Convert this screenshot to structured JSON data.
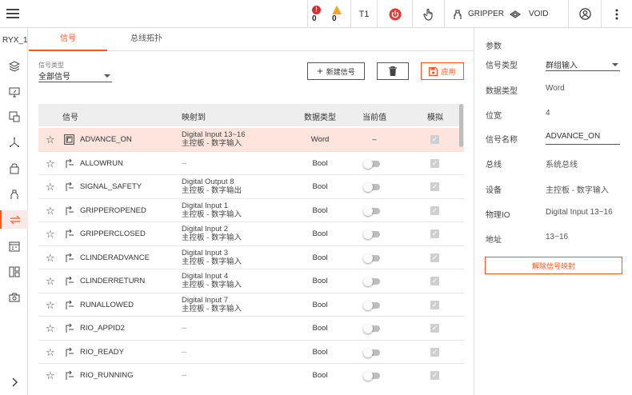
{
  "topbar": {
    "error_count": "0",
    "warning_count": "0",
    "mode": "T1",
    "tool_name": "GRIPPER",
    "workobj_name": "VOID"
  },
  "rail": {
    "title": "RYX_1"
  },
  "tabs": [
    {
      "label": "信号"
    },
    {
      "label": "总线拓扑"
    }
  ],
  "filter": {
    "label": "信号类型",
    "value": "全部信号"
  },
  "toolbar": {
    "new_label": "新建信号",
    "apply_label": "应用"
  },
  "table": {
    "headers": {
      "signal": "信号",
      "mapping": "映射到",
      "type": "数据类型",
      "value": "当前值",
      "sim": "模拟"
    },
    "rows": [
      {
        "name": "ADVANCE_ON",
        "map1": "Digital Input 13~16",
        "map2": "主控板 - 数字输入",
        "type": "Word",
        "value": "–"
      },
      {
        "name": "ALLOWRUN",
        "map1": "--",
        "map2": "",
        "type": "Bool",
        "value": ""
      },
      {
        "name": "SIGNAL_SAFETY",
        "map1": "Digital Output 8",
        "map2": "主控板 - 数字输出",
        "type": "Bool",
        "value": ""
      },
      {
        "name": "GRIPPEROPENED",
        "map1": "Digital Input 1",
        "map2": "主控板 - 数字输入",
        "type": "Bool",
        "value": ""
      },
      {
        "name": "GRIPPERCLOSED",
        "map1": "Digital Input 2",
        "map2": "主控板 - 数字输入",
        "type": "Bool",
        "value": ""
      },
      {
        "name": "CLINDERADVANCE",
        "map1": "Digital Input 3",
        "map2": "主控板 - 数字输入",
        "type": "Bool",
        "value": ""
      },
      {
        "name": "CLINDERRETURN",
        "map1": "Digital Input 4",
        "map2": "主控板 - 数字输入",
        "type": "Bool",
        "value": ""
      },
      {
        "name": "RUNALLOWED",
        "map1": "Digital Input 7",
        "map2": "主控板 - 数字输入",
        "type": "Bool",
        "value": ""
      },
      {
        "name": "RIO_APPID2",
        "map1": "--",
        "map2": "",
        "type": "Bool",
        "value": ""
      },
      {
        "name": "RIO_READY",
        "map1": "--",
        "map2": "",
        "type": "Bool",
        "value": ""
      },
      {
        "name": "RIO_RUNNING",
        "map1": "--",
        "map2": "",
        "type": "Bool",
        "value": ""
      }
    ]
  },
  "panel": {
    "header": "参数",
    "signal_type_label": "信号类型",
    "signal_type_value": "群组输入",
    "data_type_label": "数据类型",
    "data_type_value": "Word",
    "width_label": "位宽",
    "width_value": "4",
    "name_label": "信号名称",
    "name_value": "ADVANCE_ON",
    "bus_label": "总线",
    "bus_value": "系统总线",
    "device_label": "设备",
    "device_value": "主控板 - 数字输入",
    "physical_label": "物理IO",
    "physical_value": "Digital Input 13~16",
    "address_label": "地址",
    "address_value": "13~16",
    "unmap_label": "解除信号映射"
  }
}
